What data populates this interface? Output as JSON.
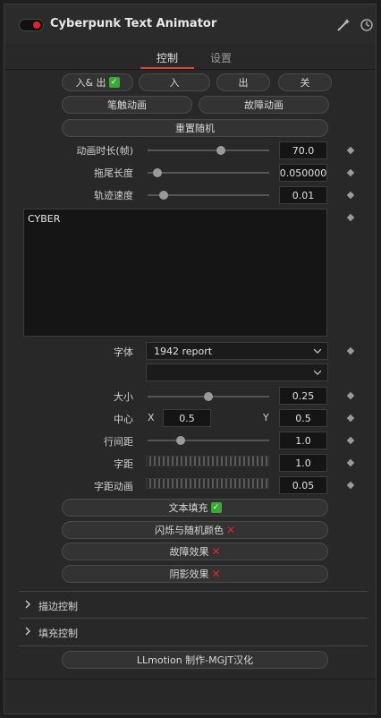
{
  "header": {
    "title": "Cyberpunk Text Animator"
  },
  "tabs": [
    {
      "label": "控制"
    },
    {
      "label": "设置"
    }
  ],
  "buttons_row1": [
    "入& 出",
    "入",
    "出",
    "关"
  ],
  "buttons_row2": [
    "笔触动画",
    "故障动画"
  ],
  "reset_random": "重置随机",
  "params": {
    "duration": {
      "label": "动画时长(帧)",
      "value": "70.0"
    },
    "trail": {
      "label": "拖尾长度",
      "value": "0.050000"
    },
    "track_speed": {
      "label": "轨迹速度",
      "value": "0.01"
    }
  },
  "text_content": "CYBER",
  "font": {
    "label": "字体",
    "value": "1942 report",
    "style_value": ""
  },
  "size": {
    "label": "大小",
    "value": "0.25"
  },
  "center": {
    "label": "中心",
    "x_label": "X",
    "x_value": "0.5",
    "y_label": "Y",
    "y_value": "0.5"
  },
  "line_spacing": {
    "label": "行间距",
    "value": "1.0"
  },
  "char_spacing": {
    "label": "字距",
    "value": "1.0"
  },
  "char_spacing_anim": {
    "label": "字距动画",
    "value": "0.05"
  },
  "toggles": {
    "fill": "文本填充",
    "flicker": "闪烁与随机颜色",
    "glitch": "故障效果",
    "shadow": "阴影效果"
  },
  "sections": [
    "描边控制",
    "填充控制"
  ],
  "credit": "LLmotion 制作-MGJT汉化",
  "icons": {
    "check": "✅",
    "cross": "❌"
  },
  "colors": {
    "accent": "#e0403a",
    "check": "#3aaa35",
    "cross": "#e0242a"
  },
  "slider_levels": {
    "duration": 0.6,
    "trail": 0.08,
    "track_speed": 0.13,
    "size": 0.5,
    "line_spacing": 0.27
  }
}
